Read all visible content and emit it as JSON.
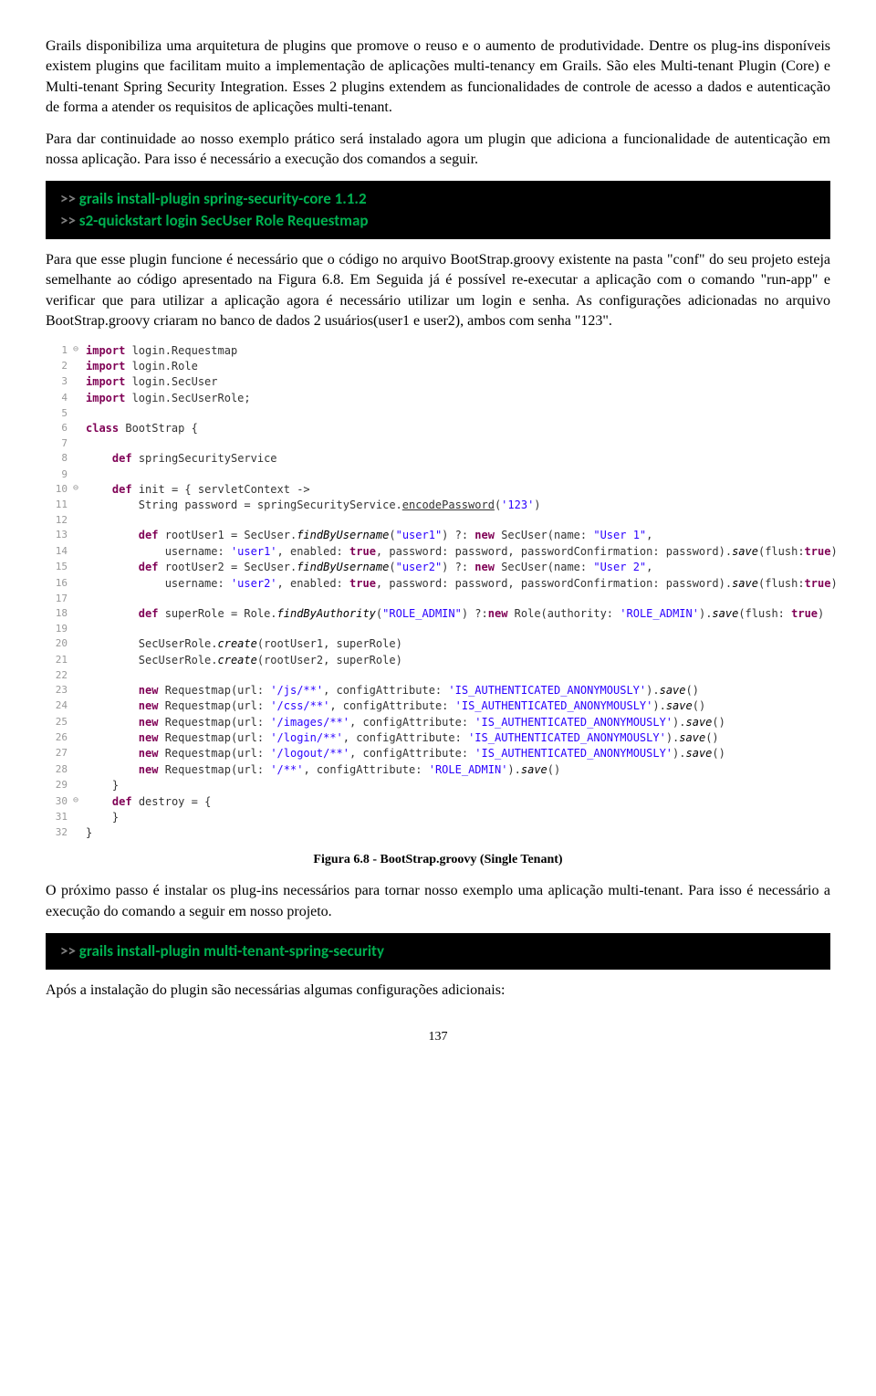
{
  "p1": "Grails disponibiliza uma arquitetura de plugins que promove o reuso e o aumento de produtividade. Dentre os plug-ins disponíveis existem plugins que facilitam muito a implementação de aplicações multi-tenancy em Grails. São eles Multi-tenant Plugin (Core) e Multi-tenant Spring Security Integration. Esses 2 plugins extendem as funcionalidades de  controle de acesso a dados e  autenticação de forma a atender os requisitos de aplicações multi-tenant.",
  "p2": "Para dar continuidade ao nosso exemplo prático será instalado agora um plugin que adiciona a funcionalidade de autenticação em nossa aplicação. Para isso é necessário a execução dos comandos a seguir.",
  "code1_l1_prompt": ">> ",
  "code1_l1_cmd": "grails install-plugin spring-security-core 1.1.2",
  "code1_l2_prompt": ">> ",
  "code1_l2_cmd": "s2-quickstart login SecUser Role Requestmap",
  "p3": "Para que esse plugin funcione é necessário que o código no arquivo  BootStrap.groovy existente na pasta \"conf\" do seu projeto esteja semelhante ao código apresentado na Figura 6.8. Em Seguida já é possível re-executar a aplicação com o comando \"run-app\" e verificar que para utilizar a aplicação agora é necessário utilizar um login e senha. As configurações adicionadas no arquivo BootStrap.groovy criaram no banco de dados 2 usuários(user1 e user2), ambos com senha \"123\".",
  "editor_lines": [
    {
      "n": "1",
      "m": "⊖",
      "html": "<span class='kw'>import</span> login.Requestmap"
    },
    {
      "n": "2",
      "m": "",
      "html": "<span class='kw'>import</span> login.Role"
    },
    {
      "n": "3",
      "m": "",
      "html": "<span class='kw'>import</span> login.SecUser"
    },
    {
      "n": "4",
      "m": "",
      "html": "<span class='kw'>import</span> login.SecUserRole;"
    },
    {
      "n": "5",
      "m": "",
      "html": ""
    },
    {
      "n": "6",
      "m": "",
      "html": "<span class='kw'>class</span> BootStrap {"
    },
    {
      "n": "7",
      "m": "",
      "html": ""
    },
    {
      "n": "8",
      "m": "",
      "html": "&nbsp;&nbsp;&nbsp;&nbsp;<span class='kw'>def</span> springSecurityService"
    },
    {
      "n": "9",
      "m": "",
      "html": ""
    },
    {
      "n": "10",
      "m": "⊖",
      "html": "&nbsp;&nbsp;&nbsp;&nbsp;<span class='kw'>def</span> init = { servletContext -&gt;"
    },
    {
      "n": "11",
      "m": "",
      "html": "&nbsp;&nbsp;&nbsp;&nbsp;&nbsp;&nbsp;&nbsp;&nbsp;String password = springSecurityService.<span class='und'>encodePassword</span>(<span class='str'>'123'</span>)"
    },
    {
      "n": "12",
      "m": "",
      "html": ""
    },
    {
      "n": "13",
      "m": "",
      "html": "&nbsp;&nbsp;&nbsp;&nbsp;&nbsp;&nbsp;&nbsp;&nbsp;<span class='kw'>def</span> rootUser1 = SecUser.<span class='mtd'>findByUsername</span>(<span class='str'>\"user1\"</span>) ?: <span class='kw'>new</span> SecUser(name: <span class='str'>\"User 1\"</span>,"
    },
    {
      "n": "14",
      "m": "",
      "html": "&nbsp;&nbsp;&nbsp;&nbsp;&nbsp;&nbsp;&nbsp;&nbsp;&nbsp;&nbsp;&nbsp;&nbsp;username: <span class='str'>'user1'</span>, enabled: <span class='kw'>true</span>, password: password, passwordConfirmation: password).<span class='mtd'>save</span>(flush:<span class='kw'>true</span>)"
    },
    {
      "n": "15",
      "m": "",
      "html": "&nbsp;&nbsp;&nbsp;&nbsp;&nbsp;&nbsp;&nbsp;&nbsp;<span class='kw'>def</span> rootUser2 = SecUser.<span class='mtd'>findByUsername</span>(<span class='str'>\"user2\"</span>) ?: <span class='kw'>new</span> SecUser(name: <span class='str'>\"User 2\"</span>,"
    },
    {
      "n": "16",
      "m": "",
      "html": "&nbsp;&nbsp;&nbsp;&nbsp;&nbsp;&nbsp;&nbsp;&nbsp;&nbsp;&nbsp;&nbsp;&nbsp;username: <span class='str'>'user2'</span>, enabled: <span class='kw'>true</span>, password: password, passwordConfirmation: password).<span class='mtd'>save</span>(flush:<span class='kw'>true</span>)"
    },
    {
      "n": "17",
      "m": "",
      "html": ""
    },
    {
      "n": "18",
      "m": "",
      "html": "&nbsp;&nbsp;&nbsp;&nbsp;&nbsp;&nbsp;&nbsp;&nbsp;<span class='kw'>def</span> superRole = Role.<span class='mtd'>findByAuthority</span>(<span class='str'>\"ROLE_ADMIN\"</span>) ?:<span class='kw'>new</span> Role(authority: <span class='str'>'ROLE_ADMIN'</span>).<span class='mtd'>save</span>(flush: <span class='kw'>true</span>)"
    },
    {
      "n": "19",
      "m": "",
      "html": ""
    },
    {
      "n": "20",
      "m": "",
      "html": "&nbsp;&nbsp;&nbsp;&nbsp;&nbsp;&nbsp;&nbsp;&nbsp;SecUserRole.<span class='mtd'>create</span>(rootUser1, superRole)"
    },
    {
      "n": "21",
      "m": "",
      "html": "&nbsp;&nbsp;&nbsp;&nbsp;&nbsp;&nbsp;&nbsp;&nbsp;SecUserRole.<span class='mtd'>create</span>(rootUser2, superRole)"
    },
    {
      "n": "22",
      "m": "",
      "html": ""
    },
    {
      "n": "23",
      "m": "",
      "html": "&nbsp;&nbsp;&nbsp;&nbsp;&nbsp;&nbsp;&nbsp;&nbsp;<span class='kw'>new</span> Requestmap(url: <span class='str'>'/js/**'</span>, configAttribute: <span class='str'>'IS_AUTHENTICATED_ANONYMOUSLY'</span>).<span class='mtd'>save</span>()"
    },
    {
      "n": "24",
      "m": "",
      "html": "&nbsp;&nbsp;&nbsp;&nbsp;&nbsp;&nbsp;&nbsp;&nbsp;<span class='kw'>new</span> Requestmap(url: <span class='str'>'/css/**'</span>, configAttribute: <span class='str'>'IS_AUTHENTICATED_ANONYMOUSLY'</span>).<span class='mtd'>save</span>()"
    },
    {
      "n": "25",
      "m": "",
      "html": "&nbsp;&nbsp;&nbsp;&nbsp;&nbsp;&nbsp;&nbsp;&nbsp;<span class='kw'>new</span> Requestmap(url: <span class='str'>'/images/**'</span>, configAttribute: <span class='str'>'IS_AUTHENTICATED_ANONYMOUSLY'</span>).<span class='mtd'>save</span>()"
    },
    {
      "n": "26",
      "m": "",
      "html": "&nbsp;&nbsp;&nbsp;&nbsp;&nbsp;&nbsp;&nbsp;&nbsp;<span class='kw'>new</span> Requestmap(url: <span class='str'>'/login/**'</span>, configAttribute: <span class='str'>'IS_AUTHENTICATED_ANONYMOUSLY'</span>).<span class='mtd'>save</span>()"
    },
    {
      "n": "27",
      "m": "",
      "html": "&nbsp;&nbsp;&nbsp;&nbsp;&nbsp;&nbsp;&nbsp;&nbsp;<span class='kw'>new</span> Requestmap(url: <span class='str'>'/logout/**'</span>, configAttribute: <span class='str'>'IS_AUTHENTICATED_ANONYMOUSLY'</span>).<span class='mtd'>save</span>()"
    },
    {
      "n": "28",
      "m": "",
      "html": "&nbsp;&nbsp;&nbsp;&nbsp;&nbsp;&nbsp;&nbsp;&nbsp;<span class='kw'>new</span> Requestmap(url: <span class='str'>'/**'</span>, configAttribute: <span class='str'>'ROLE_ADMIN'</span>).<span class='mtd'>save</span>()"
    },
    {
      "n": "29",
      "m": "",
      "html": "&nbsp;&nbsp;&nbsp;&nbsp;}"
    },
    {
      "n": "30",
      "m": "⊖",
      "html": "&nbsp;&nbsp;&nbsp;&nbsp;<span class='kw'>def</span> destroy = {"
    },
    {
      "n": "31",
      "m": "",
      "html": "&nbsp;&nbsp;&nbsp;&nbsp;}"
    },
    {
      "n": "32",
      "m": "",
      "html": "}"
    }
  ],
  "figcap": "Figura 6.8 - BootStrap.groovy (Single Tenant)",
  "p4": "O próximo passo é instalar os plug-ins necessários para tornar nosso exemplo uma aplicação multi-tenant. Para isso é necessário a execução do comando a seguir em nosso projeto.",
  "code2_l1_prompt": ">> ",
  "code2_l1_cmd": "grails install-plugin multi-tenant-spring-security",
  "p5": "Após a instalação do plugin são necessárias algumas configurações adicionais:",
  "page_number": "137"
}
